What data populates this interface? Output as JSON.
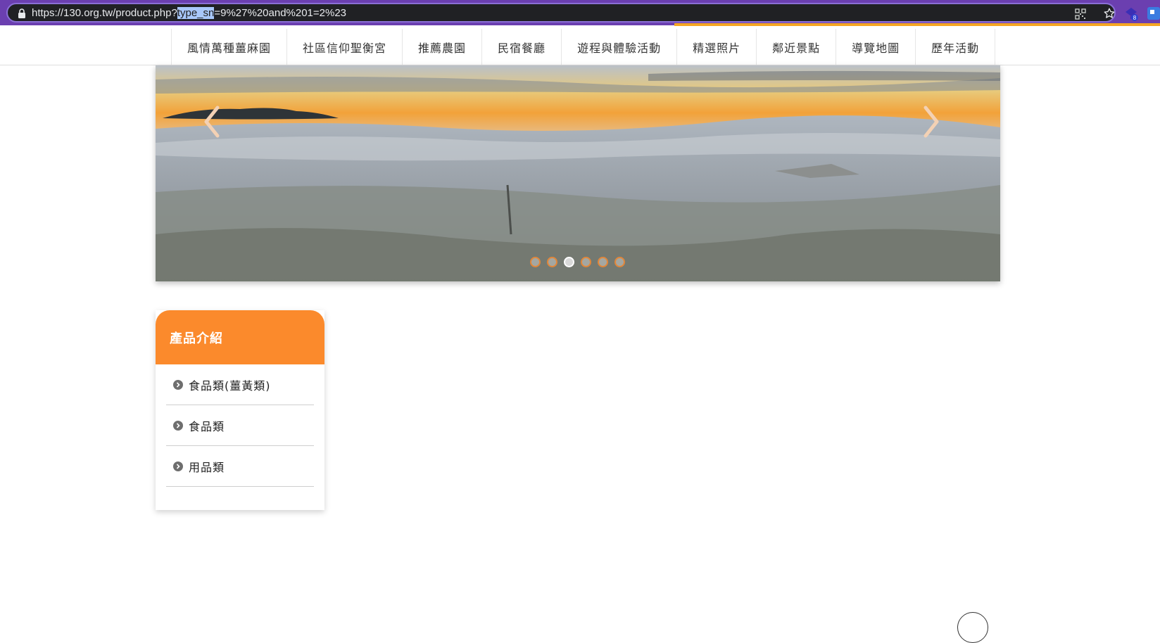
{
  "browser": {
    "url_prefix": "https://130.org.tw/product.php?",
    "url_selected": "type_sn",
    "url_suffix": "=9%27%20and%201=2%23",
    "extension_badge": "8"
  },
  "nav": {
    "items": [
      {
        "label": "風情萬種薑麻園"
      },
      {
        "label": "社區信仰聖衡宮"
      },
      {
        "label": "推薦農園"
      },
      {
        "label": "民宿餐廳"
      },
      {
        "label": "遊程與體驗活動"
      },
      {
        "label": "精選照片"
      },
      {
        "label": "鄰近景點"
      },
      {
        "label": "導覽地圖"
      },
      {
        "label": "歷年活動"
      }
    ]
  },
  "banner": {
    "slide_count": 6,
    "active_slide": 3,
    "prev_icon": "chevron-left-icon",
    "next_icon": "chevron-right-icon"
  },
  "sidebar": {
    "title": "產品介紹",
    "categories": [
      {
        "label": "食品類(薑黃類)"
      },
      {
        "label": "食品類"
      },
      {
        "label": "用品類"
      }
    ]
  },
  "colors": {
    "accent": "#fb8a2c",
    "browser_frame": "#6b3fb0",
    "dot_border": "#e2873a"
  }
}
